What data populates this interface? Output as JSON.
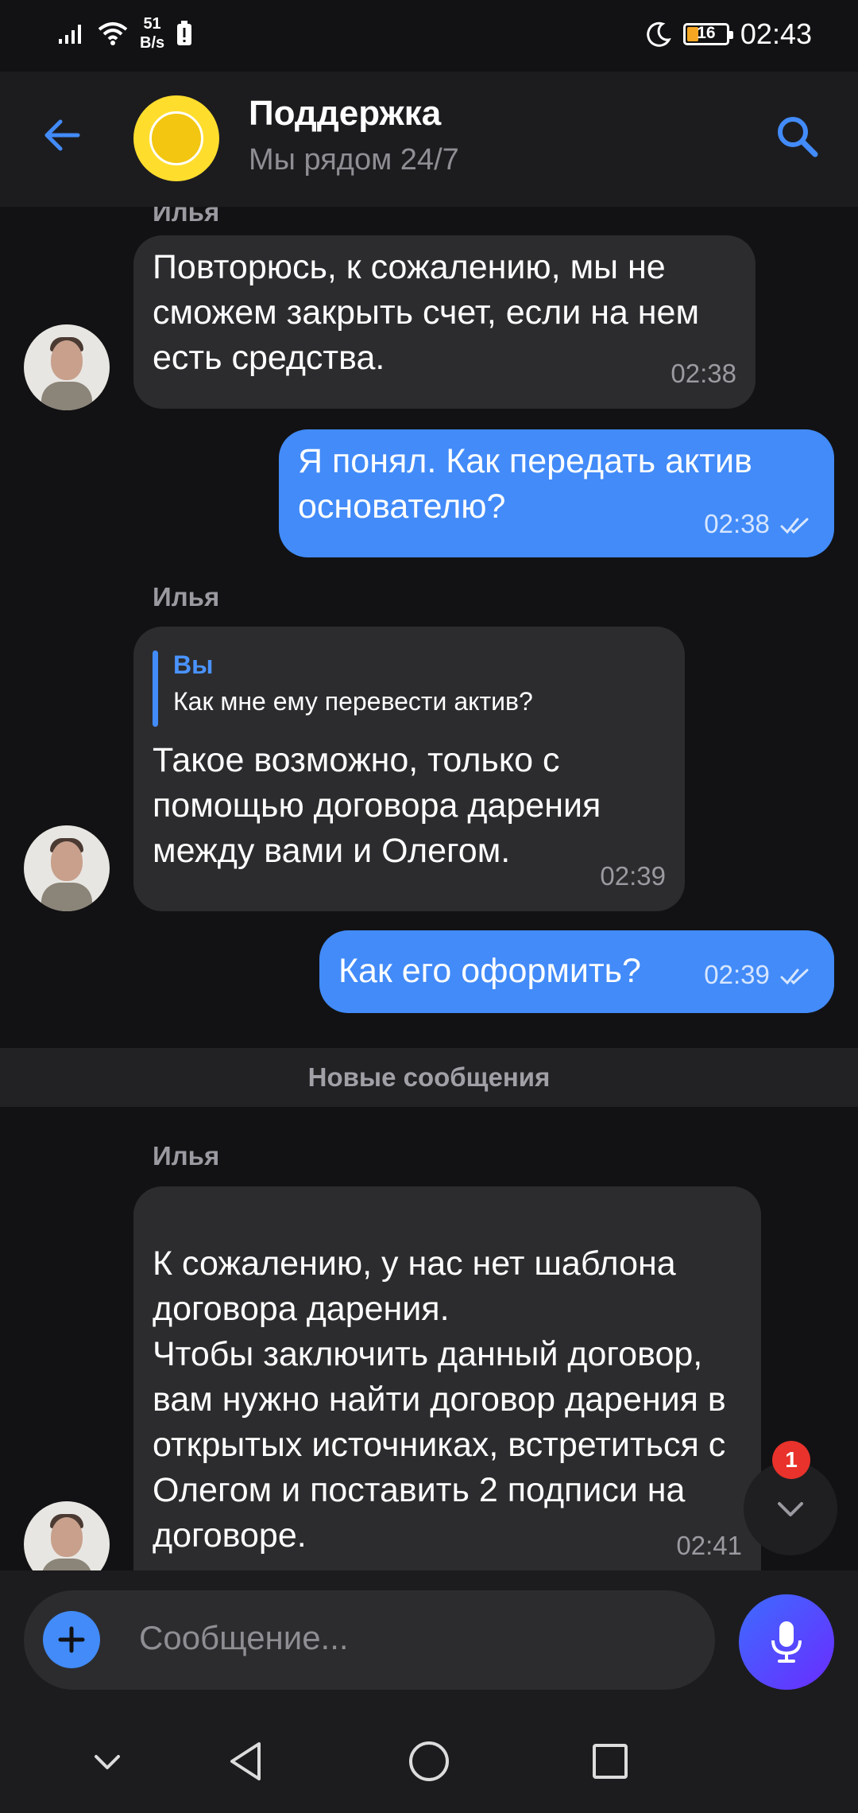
{
  "status_bar": {
    "net_speed_value": "51",
    "net_speed_unit": "B/s",
    "battery_level": "16",
    "time": "02:43"
  },
  "header": {
    "title": "Поддержка",
    "subtitle": "Мы рядом 24/7"
  },
  "messages": [
    {
      "direction": "in",
      "text": "Повторюсь, к сожалению, мы не сможем закрыть счет, если на нем есть средства.",
      "time": "02:38"
    },
    {
      "direction": "out",
      "text": "Я понял. Как передать актив основателю?",
      "time": "02:38",
      "status": "read"
    },
    {
      "direction": "in",
      "author": "Илья",
      "reply_to": {
        "author": "Вы",
        "text": "Как мне ему перевести актив?"
      },
      "text": "Такое возможно, только с помощью договора дарения между вами и Олегом.",
      "time": "02:39"
    },
    {
      "direction": "out",
      "text": "Как его оформить?",
      "time": "02:39",
      "status": "read"
    },
    {
      "direction": "in",
      "author": "Илья",
      "text": "К сожалению, у нас нет шаблона договора дарения.\nЧтобы заключить данный договор, вам нужно найти договор дарения в открытых источниках, встретиться с Олегом и поставить 2 подписи на договоре.",
      "time": "02:41"
    }
  ],
  "partial_author_top": "Илья",
  "divider_label": "Новые сообщения",
  "unread_badge": "1",
  "composer": {
    "placeholder": "Сообщение..."
  },
  "icons": {
    "back": "arrow-left-icon",
    "search": "search-icon",
    "scroll_down": "chevron-down-icon",
    "attach": "plus-icon",
    "mic": "microphone-icon",
    "read_receipt": "double-check-icon"
  },
  "colors": {
    "accent": "#428bf9",
    "incoming_bubble": "#2c2c2e",
    "background": "#121214",
    "badge": "#e8322b",
    "brand_yellow": "#ffdd2d"
  }
}
